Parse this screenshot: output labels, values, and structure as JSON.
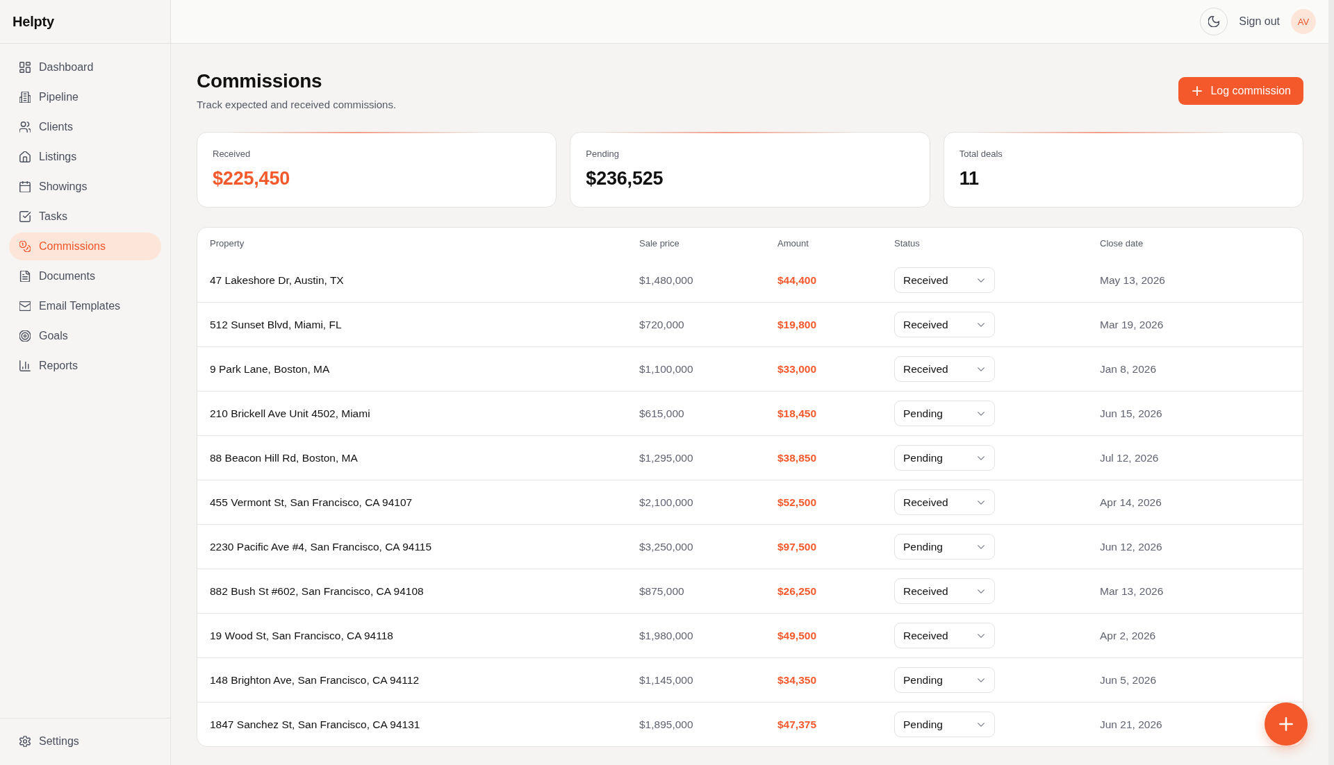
{
  "sidebar": {
    "logo": "Helpty",
    "items": [
      {
        "label": "Dashboard",
        "selected": false
      },
      {
        "label": "Pipeline",
        "selected": false
      },
      {
        "label": "Clients",
        "selected": false
      },
      {
        "label": "Listings",
        "selected": false
      },
      {
        "label": "Showings",
        "selected": false
      },
      {
        "label": "Tasks",
        "selected": false
      },
      {
        "label": "Commissions",
        "selected": true
      },
      {
        "label": "Documents",
        "selected": false
      },
      {
        "label": "Email Templates",
        "selected": false
      },
      {
        "label": "Goals",
        "selected": false
      },
      {
        "label": "Reports",
        "selected": false
      }
    ],
    "settings": {
      "label": "Settings",
      "selected": false
    }
  },
  "top_bar": {
    "sign_out": "Sign out",
    "avatar": "AV"
  },
  "page": {
    "title": "Commissions",
    "subtitle": "Track expected and received commissions.",
    "action_button": "Log commission"
  },
  "stats": [
    {
      "label": "Received",
      "value": "$225,450",
      "highlighted": true
    },
    {
      "label": "Pending",
      "value": "$236,525",
      "highlighted": false
    },
    {
      "label": "Total deals",
      "value": "11",
      "highlighted": false
    }
  ],
  "table": {
    "columns": [
      "Property",
      "Sale price",
      "Amount",
      "Status",
      "Close date"
    ],
    "rows": [
      {
        "property": "47 Lakeshore Dr, Austin, TX",
        "sale_price": "$1,480,000",
        "amount": "$44,400",
        "status": "Received",
        "close_date": "May 13, 2026"
      },
      {
        "property": "512 Sunset Blvd, Miami, FL",
        "sale_price": "$720,000",
        "amount": "$19,800",
        "status": "Received",
        "close_date": "Mar 19, 2026"
      },
      {
        "property": "9 Park Lane, Boston, MA",
        "sale_price": "$1,100,000",
        "amount": "$33,000",
        "status": "Received",
        "close_date": "Jan 8, 2026"
      },
      {
        "property": "210 Brickell Ave Unit 4502, Miami",
        "sale_price": "$615,000",
        "amount": "$18,450",
        "status": "Pending",
        "close_date": "Jun 15, 2026"
      },
      {
        "property": "88 Beacon Hill Rd, Boston, MA",
        "sale_price": "$1,295,000",
        "amount": "$38,850",
        "status": "Pending",
        "close_date": "Jul 12, 2026"
      },
      {
        "property": "455 Vermont St, San Francisco, CA 94107",
        "sale_price": "$2,100,000",
        "amount": "$52,500",
        "status": "Received",
        "close_date": "Apr 14, 2026"
      },
      {
        "property": "2230 Pacific Ave #4, San Francisco, CA 94115",
        "sale_price": "$3,250,000",
        "amount": "$97,500",
        "status": "Pending",
        "close_date": "Jun 12, 2026"
      },
      {
        "property": "882 Bush St #602, San Francisco, CA 94108",
        "sale_price": "$875,000",
        "amount": "$26,250",
        "status": "Received",
        "close_date": "Mar 13, 2026"
      },
      {
        "property": "19 Wood St, San Francisco, CA 94118",
        "sale_price": "$1,980,000",
        "amount": "$49,500",
        "status": "Received",
        "close_date": "Apr 2, 2026"
      },
      {
        "property": "148 Brighton Ave, San Francisco, CA 94112",
        "sale_price": "$1,145,000",
        "amount": "$34,350",
        "status": "Pending",
        "close_date": "Jun 5, 2026"
      },
      {
        "property": "1847 Sanchez St, San Francisco, CA 94131",
        "sale_price": "$1,895,000",
        "amount": "$47,375",
        "status": "Pending",
        "close_date": "Jun 21, 2026"
      }
    ]
  }
}
